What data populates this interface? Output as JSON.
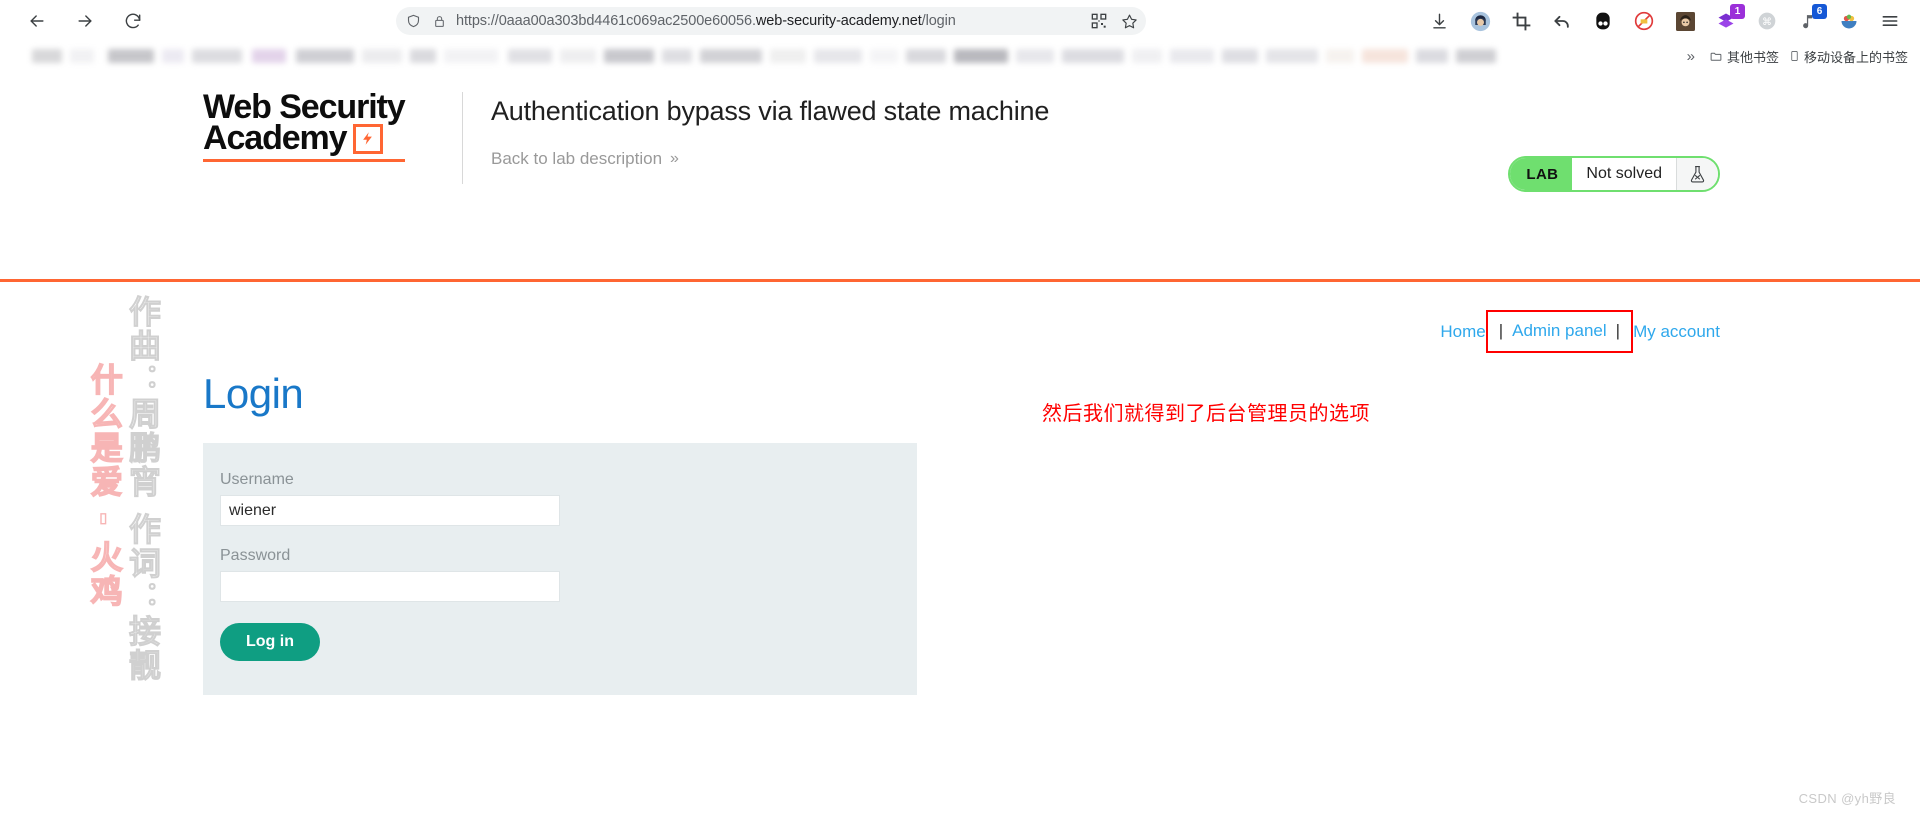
{
  "browser": {
    "nav": {
      "back": "back-arrow",
      "forward": "forward-arrow",
      "reload": "reload"
    },
    "address": {
      "scheme_path": "https://0aaa00a303bd4461c069ac2500e60056.",
      "host": "web-security-academy.net",
      "path": "/login",
      "full_url": "https://0aaa00a303bd4461c069ac2500e60056.web-security-academy.net/login",
      "shield_icon": "tracker-shield-icon",
      "lock_icon": "lock-icon",
      "qr_icon": "qr-code-icon",
      "star_icon": "bookmark-star-icon"
    },
    "extensions": [
      {
        "name": "downloads-icon",
        "glyph": "⤓",
        "color": "#3c4043",
        "badge": ""
      },
      {
        "name": "profile-avatar-icon",
        "glyph": "●",
        "color": "#6a85b6",
        "badge": ""
      },
      {
        "name": "screenshot-crop-icon",
        "glyph": "⌗",
        "color": "#3c4043",
        "badge": ""
      },
      {
        "name": "undo-arrow-icon",
        "glyph": "↰",
        "color": "#3c4043",
        "badge": ""
      },
      {
        "name": "dark-reader-icon",
        "glyph": "◑",
        "color": "#141414",
        "badge": ""
      },
      {
        "name": "adblock-icon",
        "glyph": "⊘",
        "color": "#e03b3b",
        "badge": ""
      },
      {
        "name": "anime-avatar-icon",
        "glyph": "▣",
        "color": "#7a5c3e",
        "badge": ""
      },
      {
        "name": "purple-layers-icon",
        "glyph": "◆",
        "color": "#8a2be2",
        "badge": "1",
        "badge_color": "#9b30d9"
      },
      {
        "name": "command-key-icon",
        "glyph": "⌘",
        "color": "#b9bcbe",
        "badge": ""
      },
      {
        "name": "music-note-icon",
        "glyph": "♪",
        "color": "#5f6368",
        "badge": "6",
        "badge_color": "#1558d6"
      },
      {
        "name": "fruit-bowl-icon",
        "glyph": "◕",
        "color": "#e8b04b",
        "badge": ""
      },
      {
        "name": "menu-icon",
        "glyph": "☰",
        "color": "#3c4043",
        "badge": ""
      }
    ],
    "bookmarks": {
      "overflow_label": "»",
      "other_bookmarks": "其他书签",
      "mobile_bookmarks": "移动设备上的书签",
      "folder_icon": "folder-icon",
      "mobile_icon": "mobile-device-icon"
    }
  },
  "lab": {
    "logo_line1": "Web Security",
    "logo_line2": "Academy",
    "logo_bolt": "⚡",
    "title": "Authentication bypass via flawed state machine",
    "back_link": "Back to lab description",
    "back_chevron": "»",
    "status": {
      "tag": "LAB",
      "text": "Not solved",
      "flask_icon": "flask-icon",
      "tag_color": "#6fdf6f"
    }
  },
  "site": {
    "nav": {
      "home": "Home",
      "admin_panel": "Admin panel",
      "my_account": "My account",
      "separator": "|",
      "link_color": "#2fa8ec",
      "highlight_color": "#ff0000"
    },
    "login": {
      "heading": "Login",
      "username_label": "Username",
      "username_value": "wiener",
      "password_label": "Password",
      "password_value": "",
      "submit_label": "Log in",
      "button_color": "#0f9e82",
      "panel_color": "#e8eef0"
    }
  },
  "annotations": {
    "admin_note": "然后我们就得到了后台管理员的选项",
    "note_color": "#ff0000"
  },
  "watermark": {
    "line_gray": "作曲：周鹏宵  作词：接靓",
    "line_pink": "什么是爱 - 火鸡",
    "csdn": "CSDN @yh野良"
  }
}
